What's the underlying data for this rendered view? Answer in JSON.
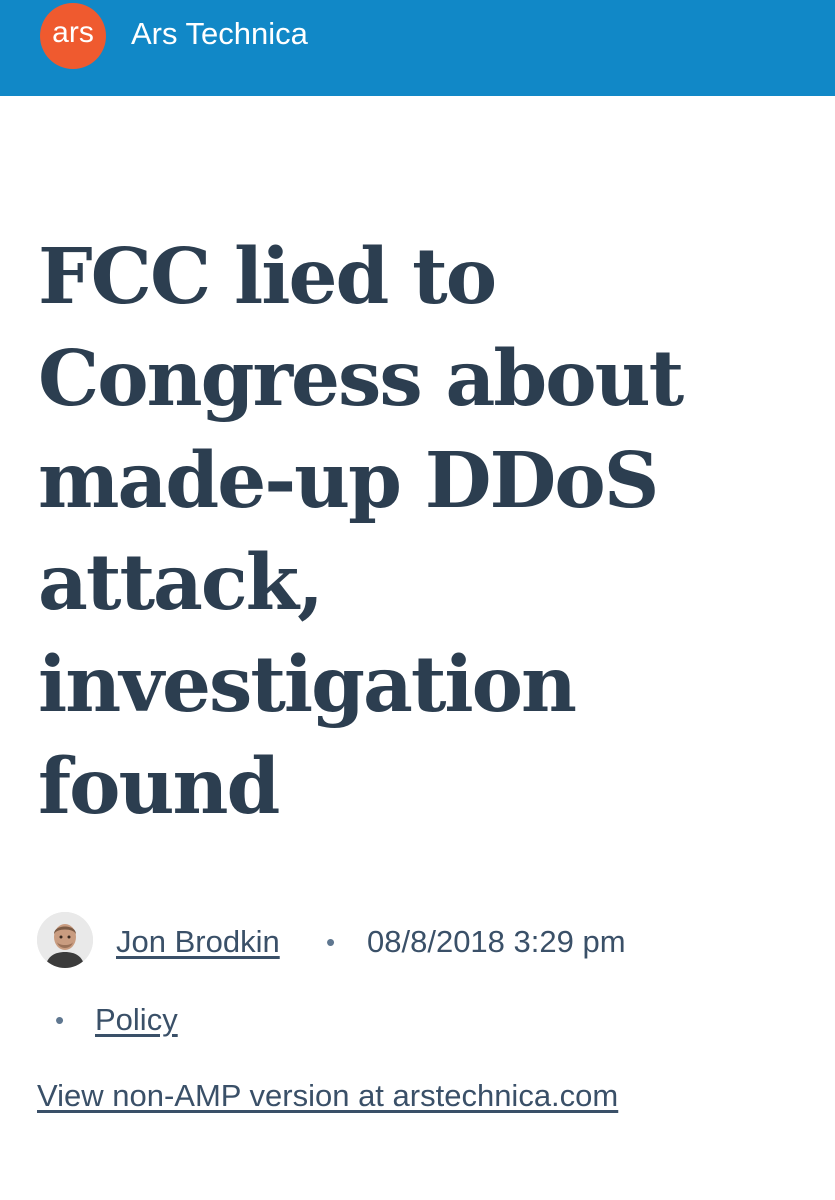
{
  "header": {
    "logo_text": "ars",
    "site_name": "Ars Technica",
    "colors": {
      "bar": "#1188c7",
      "logo": "#ef5a2f"
    }
  },
  "article": {
    "title": "FCC lied to Congress about made-up DDoS attack, investigation found",
    "author": "Jon Brodkin",
    "separator": "•",
    "date": "08/8/2018 3:29 pm",
    "category": "Policy",
    "non_amp_link": "View non-AMP version at arstechnica.com",
    "text_color": "#2c3e50"
  },
  "icons": {
    "avatar": "author-photo"
  }
}
